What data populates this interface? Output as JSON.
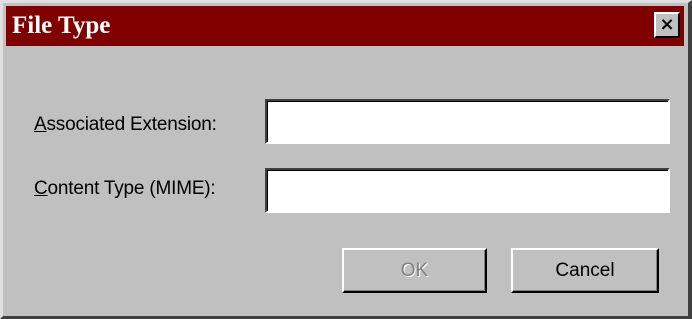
{
  "window": {
    "title": "File Type",
    "close_glyph": "×"
  },
  "form": {
    "extension_label_mnemonic": "A",
    "extension_label_rest": "ssociated Extension:",
    "extension_value": "",
    "mime_label_mnemonic": "C",
    "mime_label_rest": "ontent Type (MIME):",
    "mime_value": ""
  },
  "buttons": {
    "ok_label": "OK",
    "ok_enabled": false,
    "cancel_label": "Cancel"
  },
  "colors": {
    "titlebar": "#800000",
    "dialog_face": "#c0c0c0",
    "disabled_text": "#808080"
  },
  "icons": {
    "close": "close-icon"
  }
}
